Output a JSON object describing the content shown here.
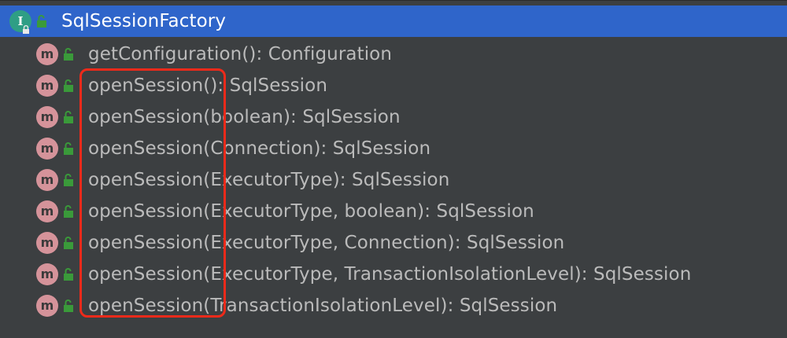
{
  "root": {
    "icon": "interface-icon",
    "icon_letter": "I",
    "label": "SqlSessionFactory"
  },
  "methods": [
    {
      "label": "getConfiguration(): Configuration"
    },
    {
      "label": "openSession(): SqlSession"
    },
    {
      "label": "openSession(boolean): SqlSession"
    },
    {
      "label": "openSession(Connection): SqlSession"
    },
    {
      "label": "openSession(ExecutorType): SqlSession"
    },
    {
      "label": "openSession(ExecutorType, boolean): SqlSession"
    },
    {
      "label": "openSession(ExecutorType, Connection): SqlSession"
    },
    {
      "label": "openSession(ExecutorType, TransactionIsolationLevel): SqlSession"
    },
    {
      "label": "openSession(TransactionIsolationLevel): SqlSession"
    }
  ],
  "method_icon_letter": "m",
  "colors": {
    "background": "#3c3f41",
    "selection": "#2f65ca",
    "interface_icon": "#2f9e85",
    "method_icon": "#d5939a",
    "public_badge": "#3a9a3a",
    "highlight": "#ee2a1a"
  }
}
